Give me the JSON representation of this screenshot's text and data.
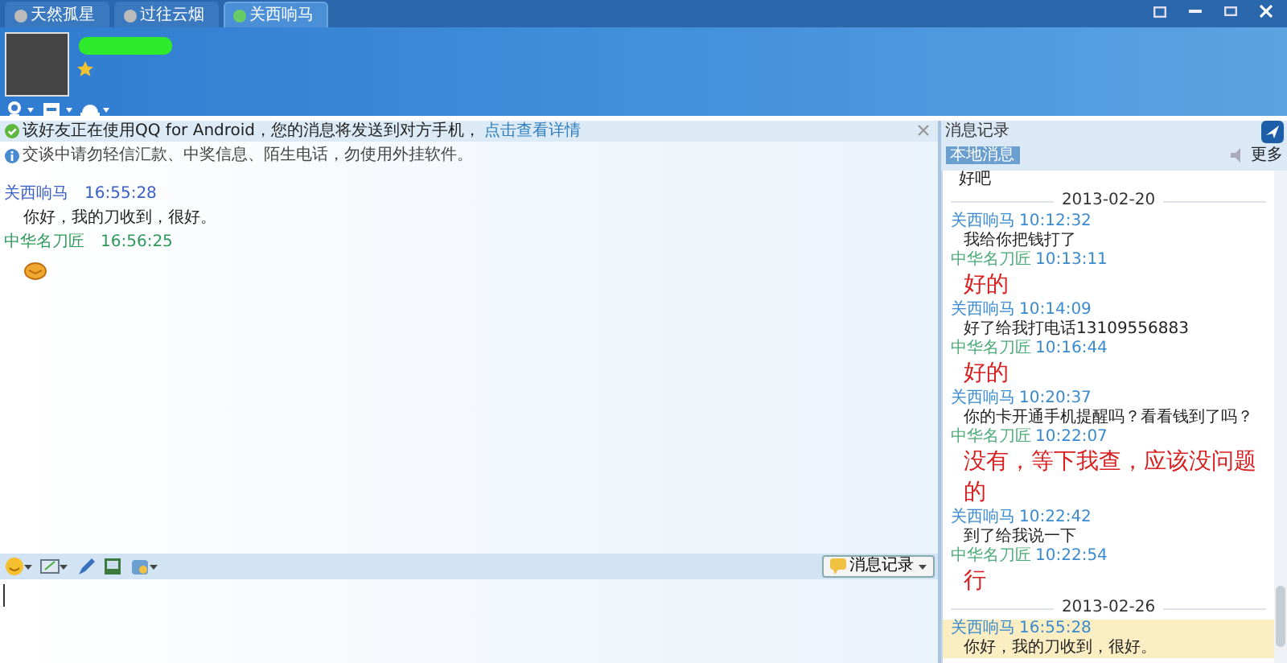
{
  "tabs": [
    {
      "label": "天然孤星",
      "selected": false
    },
    {
      "label": "过往云烟",
      "selected": false
    },
    {
      "label": "关西响马",
      "selected": true
    }
  ],
  "notice": {
    "text": "该好友正在使用QQ for Android，您的消息将发送到对方手机，",
    "link": "点击查看详情"
  },
  "warning": "交谈中请勿轻信汇款、中奖信息、陌生电话，勿使用外挂软件。",
  "chat": [
    {
      "sender": "关西响马",
      "time": "16:55:28",
      "color": "#3a5fc8",
      "kind": "text",
      "text": "你好，我的刀收到，很好。"
    },
    {
      "sender": "中华名刀匠",
      "time": "16:56:25",
      "color": "#2e9a5a",
      "kind": "emoji"
    }
  ],
  "history_button": "消息记录",
  "history": {
    "title": "消息记录",
    "tab": "本地消息",
    "more": "更多",
    "items": [
      {
        "kind": "text",
        "text": "好吧"
      },
      {
        "kind": "date",
        "text": "2013-02-20"
      },
      {
        "kind": "message",
        "sender": "关西响马",
        "time": "10:12:32",
        "color": "#3a8ad0",
        "text": "我给你把钱打了",
        "large": false,
        "highlighted": false
      },
      {
        "kind": "message",
        "sender": "中华名刀匠",
        "time": "10:13:11",
        "color": "#4aaa78",
        "text": "好的",
        "large": true,
        "highlighted": false
      },
      {
        "kind": "message",
        "sender": "关西响马",
        "time": "10:14:09",
        "color": "#3a8ad0",
        "text": "好了给我打电话13109556883",
        "large": false,
        "highlighted": false
      },
      {
        "kind": "message",
        "sender": "中华名刀匠",
        "time": "10:16:44",
        "color": "#4aaa78",
        "text": "好的",
        "large": true,
        "highlighted": false
      },
      {
        "kind": "message",
        "sender": "关西响马",
        "time": "10:20:37",
        "color": "#3a8ad0",
        "text": "你的卡开通手机提醒吗？看看钱到了吗？",
        "large": false,
        "highlighted": false
      },
      {
        "kind": "message",
        "sender": "中华名刀匠",
        "time": "10:22:07",
        "color": "#4aaa78",
        "text": "没有，等下我查，应该没问题的",
        "large": true,
        "highlighted": false
      },
      {
        "kind": "message",
        "sender": "关西响马",
        "time": "10:22:42",
        "color": "#3a8ad0",
        "text": "到了给我说一下",
        "large": false,
        "highlighted": false
      },
      {
        "kind": "message",
        "sender": "中华名刀匠",
        "time": "10:22:54",
        "color": "#4aaa78",
        "text": "行",
        "large": true,
        "highlighted": false
      },
      {
        "kind": "date",
        "text": "2013-02-26"
      },
      {
        "kind": "message",
        "sender": "关西响马",
        "time": "16:55:28",
        "color": "#3a8ad0",
        "text": "你好，我的刀收到，很好。",
        "large": false,
        "highlighted": true
      }
    ]
  }
}
